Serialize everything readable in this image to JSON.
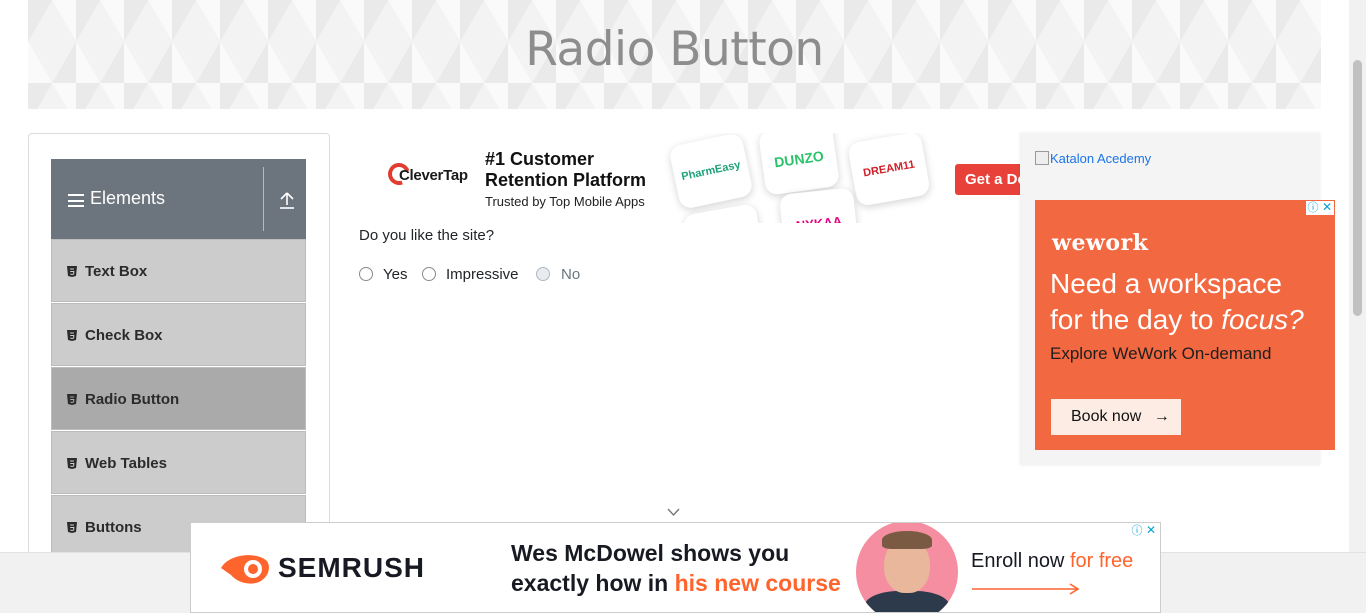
{
  "header": {
    "title": "Radio Button"
  },
  "sidebar": {
    "group_label": "Elements",
    "items": [
      {
        "label": "Text Box"
      },
      {
        "label": "Check Box"
      },
      {
        "label": "Radio Button"
      },
      {
        "label": "Web Tables"
      },
      {
        "label": "Buttons"
      }
    ],
    "active_item": "Radio Button"
  },
  "top_ad": {
    "brand": "CleverTap",
    "headline_line1": "#1 Customer",
    "headline_line2": "Retention Platform",
    "subline": "Trusted by Top Mobile Apps",
    "apps": [
      "PharmEasy",
      "DUNZO",
      "DREAM11",
      "NYKAA"
    ],
    "cta": "Get a Demo"
  },
  "form": {
    "question": "Do you like the site?",
    "options": [
      {
        "label": "Yes",
        "disabled": false,
        "checked": false
      },
      {
        "label": "Impressive",
        "disabled": false,
        "checked": false
      },
      {
        "label": "No",
        "disabled": true,
        "checked": false
      }
    ]
  },
  "right_panel": {
    "broken_image_alt": "Katalon Acedemy"
  },
  "wework_ad": {
    "brand": "wework",
    "headline_line1": "Need a workspace",
    "headline_line2_pre": "for the day to ",
    "headline_line2_em": "focus?",
    "subline": "Explore WeWork On-demand",
    "cta": "Book now",
    "cta_arrow": "→",
    "adchoice": "ⓘ",
    "close": "✕"
  },
  "semrush_ad": {
    "brand": "SEMRUSH",
    "headline_line1": "Wes McDowel shows you",
    "headline_line2_pre": "exactly how in ",
    "headline_line2_hl": "his new course",
    "cta_pre": "Enroll now ",
    "cta_hl": "for free",
    "adchoice": "ⓘ",
    "close": "✕"
  },
  "colors": {
    "sidebar_header": "#6c757d",
    "menu_item": "#cccccc",
    "menu_item_active": "#aaaaaa",
    "wework_orange": "#f26841",
    "semrush_orange": "#ff642d",
    "clevertap_red": "#e8413a"
  }
}
